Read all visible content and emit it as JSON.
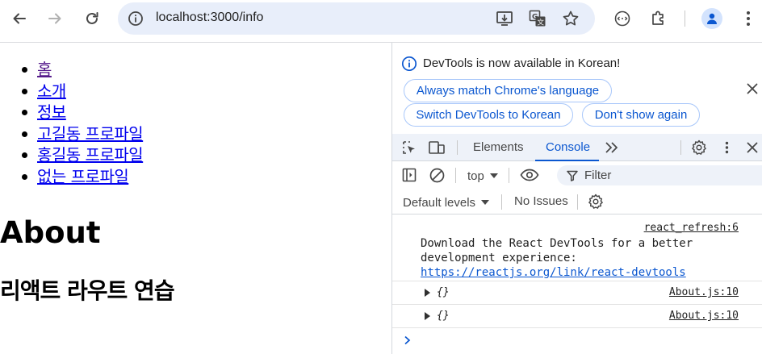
{
  "browser": {
    "url": "localhost:3000/info"
  },
  "page": {
    "nav": [
      {
        "label": "홈",
        "visited": true
      },
      {
        "label": "소개",
        "visited": false
      },
      {
        "label": "정보",
        "visited": false
      },
      {
        "label": "고길동 프로파일",
        "visited": false
      },
      {
        "label": "홍길동 프로파일",
        "visited": false
      },
      {
        "label": "없는 프로파일",
        "visited": false
      }
    ],
    "heading": "About",
    "subheading": "리액트 라우트 연습"
  },
  "devtools": {
    "notice": {
      "text": "DevTools is now available in Korean!",
      "always_match": "Always match Chrome's language",
      "switch_korean": "Switch DevTools to Korean",
      "dont_show": "Don't show again"
    },
    "tabs": {
      "elements": "Elements",
      "console": "Console"
    },
    "console_toolbar": {
      "context": "top",
      "filter_placeholder": "Filter",
      "levels": "Default levels",
      "issues": "No Issues"
    },
    "messages": [
      {
        "source": "react_refresh:6",
        "lines": [
          "Download the React DevTools for a better",
          "development experience:"
        ],
        "link": "https://reactjs.org/link/react-devtools"
      },
      {
        "source": "About.js:10",
        "value": "{}"
      },
      {
        "source": "About.js:10",
        "value": "{}"
      }
    ]
  },
  "colors": {
    "accent": "#0b57d0",
    "omnibox_bg": "#e8eefa",
    "link": "#0000ee",
    "visited_link": "#551a8b"
  }
}
